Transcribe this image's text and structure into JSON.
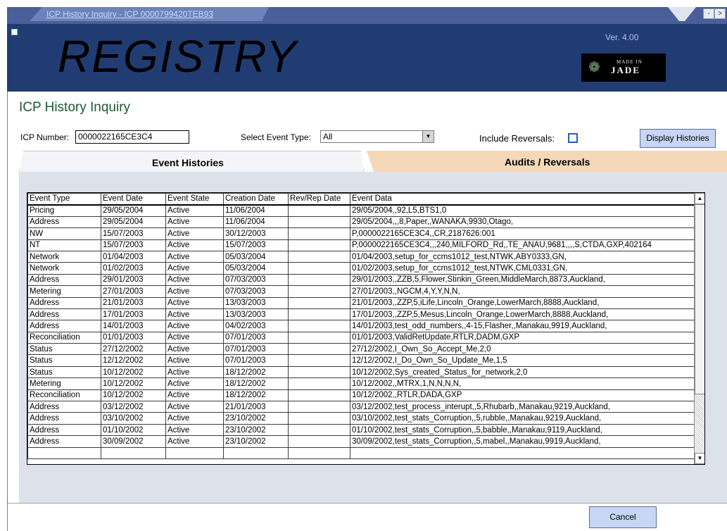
{
  "window": {
    "title": "ICP History Inquiry -  ICP 0000799420TEB93",
    "minimize_glyph": "-",
    "close_glyph": ">"
  },
  "header": {
    "logo": "REGISTRY",
    "version": "Ver. 4.00",
    "badge_small": "MADE IN",
    "badge_big": "JADE"
  },
  "form": {
    "page_title": "ICP History Inquiry",
    "icp_number_label": "ICP Number:",
    "icp_number_value": "0000022165CE3C4",
    "event_type_label": "Select Event Type:",
    "event_type_value": "All",
    "include_reversals_label": "Include Reversals:",
    "include_reversals_checked": false,
    "display_button": "Display Histories"
  },
  "tabs": [
    {
      "label": "Event Histories",
      "active": true
    },
    {
      "label": "Audits / Reversals",
      "active": false
    }
  ],
  "grid": {
    "columns": [
      "Event Type",
      "Event Date",
      "Event State",
      "Creation Date",
      "Rev/Rep Date",
      "Event Data"
    ],
    "rows": [
      [
        "Pricing",
        "29/05/2004",
        "Active",
        "11/06/2004",
        "",
        "29/05/2004,,92,L5,BTS1,0"
      ],
      [
        "Address",
        "29/05/2004",
        "Active",
        "11/06/2004",
        "",
        "29/05/2004,,,8,Paper,,WANAKA,9930,Otago,"
      ],
      [
        "NW",
        "15/07/2003",
        "Active",
        "30/12/2003",
        "",
        "P,0000022165CE3C4,,CR,2187626:001"
      ],
      [
        "NT",
        "15/07/2003",
        "Active",
        "15/07/2003",
        "",
        "P,0000022165CE3C4,,,240,MILFORD_Rd,,TE_ANAU,9681,,,,S,CTDA,GXP,402164"
      ],
      [
        "Network",
        "01/04/2003",
        "Active",
        "05/03/2004",
        "",
        "01/04/2003,setup_for_ccms1012_test,NTWK,ABY0333,GN,"
      ],
      [
        "Network",
        "01/02/2003",
        "Active",
        "05/03/2004",
        "",
        "01/02/2003,setup_for_ccms1012_test,NTWK,CML0331,GN,"
      ],
      [
        "Address",
        "29/01/2003",
        "Active",
        "07/03/2003",
        "",
        "29/01/2003,,ZZB,5,Flower,Stinkin_Green,MiddleMarch,8873,Auckland,"
      ],
      [
        "Metering",
        "27/01/2003",
        "Active",
        "07/03/2003",
        "",
        "27/01/2003,,NGCM,4,Y,Y,N,N,"
      ],
      [
        "Address",
        "21/01/2003",
        "Active",
        "13/03/2003",
        "",
        "21/01/2003,,ZZP,5,iLife,Lincoln_Orange,LowerMarch,8888,Auckland,"
      ],
      [
        "Address",
        "17/01/2003",
        "Active",
        "13/03/2003",
        "",
        "17/01/2003,,ZZP,5,Mesus,Lincoln_Orange,LowerMarch,8888,Auckland,"
      ],
      [
        "Address",
        "14/01/2003",
        "Active",
        "04/02/2003",
        "",
        "14/01/2003,test_odd_numbers,,4-15,Flasher,,Manakau,9919,Auckland,"
      ],
      [
        "Reconciliation",
        "01/01/2003",
        "Active",
        "07/01/2003",
        "",
        "01/01/2003,ValidRetUpdate,RTLR,DADM,GXP"
      ],
      [
        "Status",
        "27/12/2002",
        "Active",
        "07/01/2003",
        "",
        "27/12/2002,I_Own_So_Accept_Me,2,0"
      ],
      [
        "Status",
        "12/12/2002",
        "Active",
        "07/01/2003",
        "",
        "12/12/2002,I_Do_Own_So_Update_Me,1,5"
      ],
      [
        "Status",
        "10/12/2002",
        "Active",
        "18/12/2002",
        "",
        "10/12/2002,Sys_created_Status_for_network,2,0"
      ],
      [
        "Metering",
        "10/12/2002",
        "Active",
        "18/12/2002",
        "",
        "10/12/2002,,MTRX,1,N,N,N,N,"
      ],
      [
        "Reconciliation",
        "10/12/2002",
        "Active",
        "18/12/2002",
        "",
        "10/12/2002,,RTLR,DADA,GXP"
      ],
      [
        "Address",
        "03/12/2002",
        "Active",
        "21/01/2003",
        "",
        "03/12/2002,test_process_interupt,,5,Rhubarb,,Manakau,9219,Auckland,"
      ],
      [
        "Address",
        "03/10/2002",
        "Active",
        "23/10/2002",
        "",
        "03/10/2002,test_stats_Corruption,,5,rubble,,Manakau,9219,Auckland,"
      ],
      [
        "Address",
        "01/10/2002",
        "Active",
        "23/10/2002",
        "",
        "01/10/2002,test_stats_Corruption,,5,babble,,Manakau,9119,Auckland,"
      ],
      [
        "Address",
        "30/09/2002",
        "Active",
        "23/10/2002",
        "",
        "30/09/2002,test_stats_Corruption,,5,mabel,,Manakau,9919,Auckland,"
      ],
      [
        "",
        "",
        "",
        "",
        "",
        ""
      ]
    ]
  },
  "footer": {
    "cancel_button": "Cancel"
  },
  "colors": {
    "banner": "#213c72",
    "title_bar": "#4a5f98",
    "page_title": "#1a5a36",
    "inactive_tab": "#f5d8b8",
    "panel": "#dde2ea",
    "button": "#c6d6f4"
  }
}
